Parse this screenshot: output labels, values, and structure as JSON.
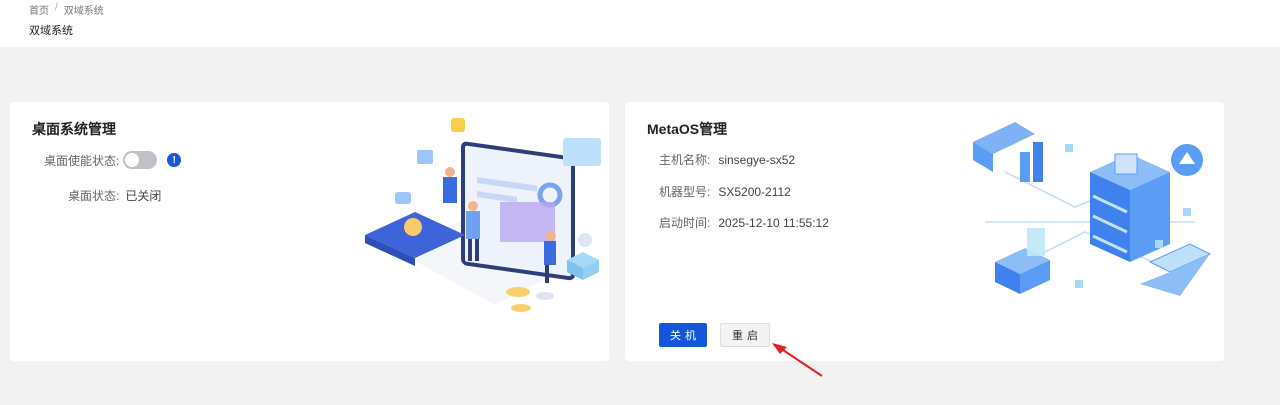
{
  "breadcrumb": {
    "home": "首页",
    "separator": "/",
    "current": "双域系统"
  },
  "page": {
    "title": "双域系统"
  },
  "desktop_card": {
    "title": "桌面系统管理",
    "enable_label": "桌面使能状态:",
    "info_glyph": "!",
    "status_label": "桌面状态:",
    "status_value": "已关闭",
    "toggle_on": false
  },
  "metaos_card": {
    "title": "MetaOS管理",
    "hostname_label": "主机名称:",
    "hostname_value": "sinsegye-sx52",
    "model_label": "机器型号:",
    "model_value": "SX5200-2112",
    "boot_label": "启动时间:",
    "boot_value": "2025-12-10 11:55:12",
    "shutdown_button": "关机",
    "restart_button": "重启"
  },
  "colors": {
    "primary": "#1456d9",
    "arrow": "#e02020",
    "illustration": "#5b9cf5"
  }
}
